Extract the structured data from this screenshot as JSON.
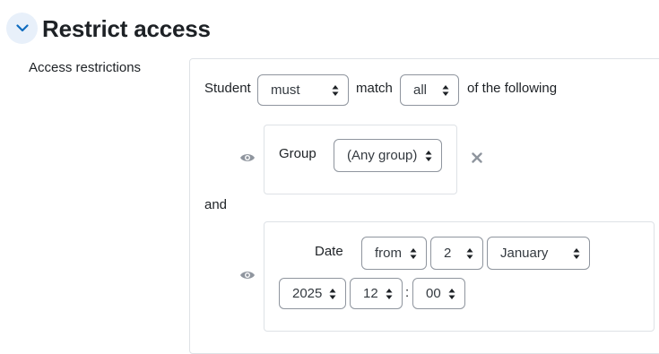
{
  "section": {
    "title": "Restrict access",
    "collapse_icon": "chevron-down-icon"
  },
  "form": {
    "label": "Access restrictions"
  },
  "restriction": {
    "student_label": "Student",
    "must_value": "must",
    "match_label": "match",
    "all_value": "all",
    "of_following_label": "of the following",
    "and_label": "and",
    "group_condition": {
      "eye_icon": "eye-icon",
      "label": "Group",
      "value": "(Any group)",
      "delete_icon": "close-icon"
    },
    "date_condition": {
      "eye_icon": "eye-icon",
      "label": "Date",
      "direction": "from",
      "day": "2",
      "month": "January",
      "year": "2025",
      "hour": "12",
      "separator": ":",
      "minute": "00"
    }
  },
  "colors": {
    "accent": "#0f6cbf",
    "icon_gray": "#8f959e",
    "border": "#dee2e6"
  }
}
